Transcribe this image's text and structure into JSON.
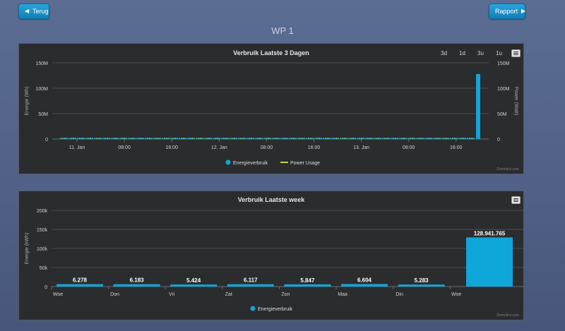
{
  "nav": {
    "back_label": "Terug",
    "report_label": "Rapport"
  },
  "page": {
    "title": "WP 1"
  },
  "chart1": {
    "range_buttons": [
      "3d",
      "1d",
      "3u",
      "1u"
    ],
    "legend": [
      "Energieverbruik",
      "Power Usage"
    ],
    "credit": "Domoticz.com"
  },
  "chart2": {
    "legend": [
      "Energieverbruik"
    ],
    "credit": "Domoticz.com"
  },
  "colors": {
    "bar": "#0fa6d9",
    "line": "#c8d633",
    "grid": "#4a4c50",
    "text": "#d0d0d0"
  },
  "chart_data": [
    {
      "type": "bar",
      "title": "Verbruik Laatste 3 Dagen",
      "ylabel": "Energie (Wh)",
      "y2label": "Power (Watt)",
      "ylim": [
        0,
        150000000
      ],
      "yticks": [
        "0",
        "50M",
        "100M",
        "150M"
      ],
      "y2ticks": [
        "0",
        "50M",
        "100M",
        "150M"
      ],
      "x_tick_labels": [
        "11. Jan",
        "08:00",
        "16:00",
        "12. Jan",
        "08:00",
        "16:00",
        "13. Jan",
        "08:00",
        "16:00"
      ],
      "series": [
        {
          "name": "Energieverbruik",
          "type": "bar",
          "note_values": "near zero except final spike",
          "spike_value": 128000000
        },
        {
          "name": "Power Usage",
          "type": "line",
          "values_constant": 0
        }
      ],
      "grid": true,
      "legend_position": "bottom"
    },
    {
      "type": "bar",
      "title": "Verbruik Laatste week",
      "ylabel": "Energie (kWh)",
      "ylim": [
        0,
        200000
      ],
      "yticks": [
        "0",
        "50k",
        "100k",
        "150k",
        "200k"
      ],
      "categories": [
        "Woe",
        "Don",
        "Vri",
        "Zat",
        "Zon",
        "Maa",
        "Din",
        "Woe"
      ],
      "series": [
        {
          "name": "Energieverbruik",
          "values": [
            6278,
            6183,
            5424,
            6117,
            5847,
            6604,
            5283,
            128941.765
          ],
          "labels": [
            "6.278",
            "6.183",
            "5.424",
            "6.117",
            "5.847",
            "6.604",
            "5.283",
            "128.941.765"
          ]
        }
      ],
      "grid": true,
      "legend_position": "bottom"
    }
  ]
}
